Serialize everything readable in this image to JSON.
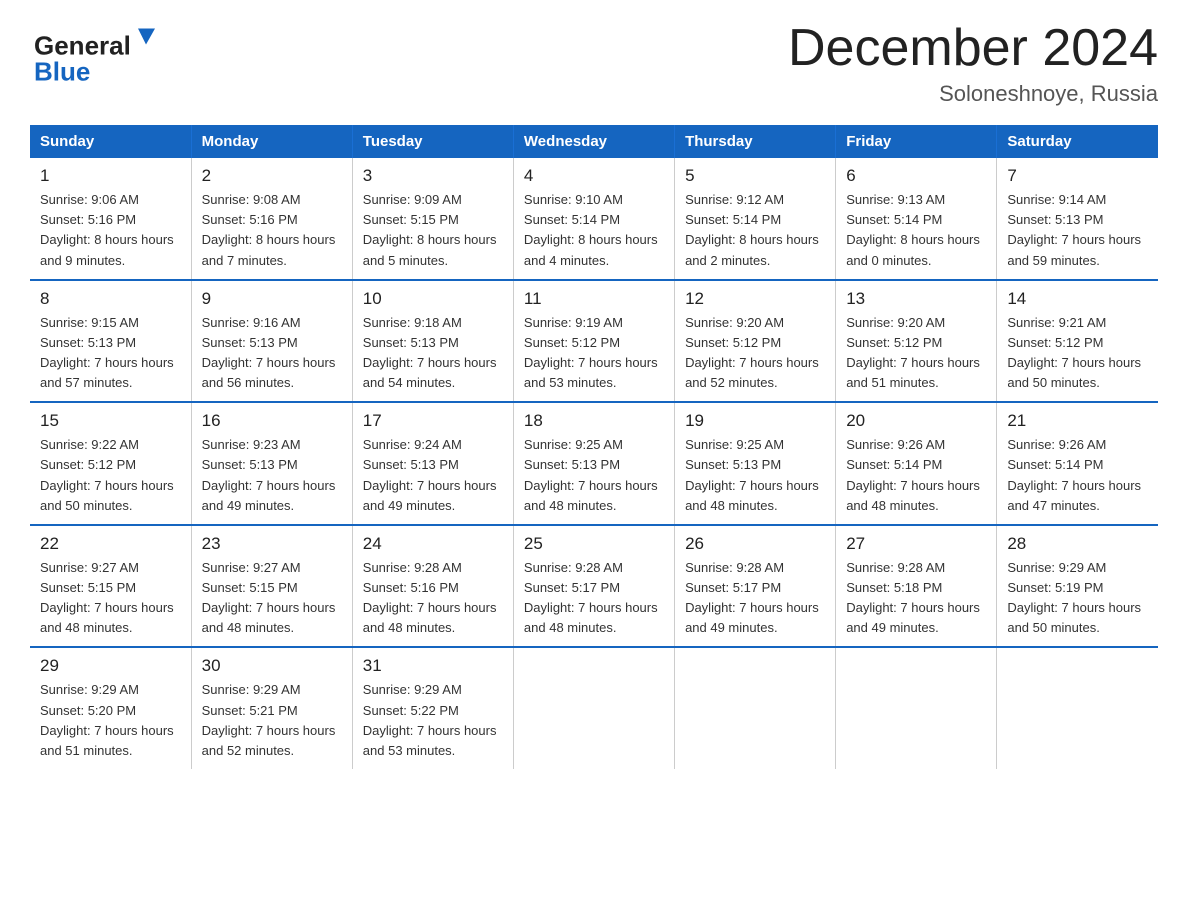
{
  "logo": {
    "line1": "General",
    "line2": "Blue",
    "triangle": "▶"
  },
  "title": "December 2024",
  "subtitle": "Soloneshnoye, Russia",
  "days_header": [
    "Sunday",
    "Monday",
    "Tuesday",
    "Wednesday",
    "Thursday",
    "Friday",
    "Saturday"
  ],
  "weeks": [
    [
      {
        "num": "1",
        "sunrise": "9:06 AM",
        "sunset": "5:16 PM",
        "daylight": "8 hours and 9 minutes."
      },
      {
        "num": "2",
        "sunrise": "9:08 AM",
        "sunset": "5:16 PM",
        "daylight": "8 hours and 7 minutes."
      },
      {
        "num": "3",
        "sunrise": "9:09 AM",
        "sunset": "5:15 PM",
        "daylight": "8 hours and 5 minutes."
      },
      {
        "num": "4",
        "sunrise": "9:10 AM",
        "sunset": "5:14 PM",
        "daylight": "8 hours and 4 minutes."
      },
      {
        "num": "5",
        "sunrise": "9:12 AM",
        "sunset": "5:14 PM",
        "daylight": "8 hours and 2 minutes."
      },
      {
        "num": "6",
        "sunrise": "9:13 AM",
        "sunset": "5:14 PM",
        "daylight": "8 hours and 0 minutes."
      },
      {
        "num": "7",
        "sunrise": "9:14 AM",
        "sunset": "5:13 PM",
        "daylight": "7 hours and 59 minutes."
      }
    ],
    [
      {
        "num": "8",
        "sunrise": "9:15 AM",
        "sunset": "5:13 PM",
        "daylight": "7 hours and 57 minutes."
      },
      {
        "num": "9",
        "sunrise": "9:16 AM",
        "sunset": "5:13 PM",
        "daylight": "7 hours and 56 minutes."
      },
      {
        "num": "10",
        "sunrise": "9:18 AM",
        "sunset": "5:13 PM",
        "daylight": "7 hours and 54 minutes."
      },
      {
        "num": "11",
        "sunrise": "9:19 AM",
        "sunset": "5:12 PM",
        "daylight": "7 hours and 53 minutes."
      },
      {
        "num": "12",
        "sunrise": "9:20 AM",
        "sunset": "5:12 PM",
        "daylight": "7 hours and 52 minutes."
      },
      {
        "num": "13",
        "sunrise": "9:20 AM",
        "sunset": "5:12 PM",
        "daylight": "7 hours and 51 minutes."
      },
      {
        "num": "14",
        "sunrise": "9:21 AM",
        "sunset": "5:12 PM",
        "daylight": "7 hours and 50 minutes."
      }
    ],
    [
      {
        "num": "15",
        "sunrise": "9:22 AM",
        "sunset": "5:12 PM",
        "daylight": "7 hours and 50 minutes."
      },
      {
        "num": "16",
        "sunrise": "9:23 AM",
        "sunset": "5:13 PM",
        "daylight": "7 hours and 49 minutes."
      },
      {
        "num": "17",
        "sunrise": "9:24 AM",
        "sunset": "5:13 PM",
        "daylight": "7 hours and 49 minutes."
      },
      {
        "num": "18",
        "sunrise": "9:25 AM",
        "sunset": "5:13 PM",
        "daylight": "7 hours and 48 minutes."
      },
      {
        "num": "19",
        "sunrise": "9:25 AM",
        "sunset": "5:13 PM",
        "daylight": "7 hours and 48 minutes."
      },
      {
        "num": "20",
        "sunrise": "9:26 AM",
        "sunset": "5:14 PM",
        "daylight": "7 hours and 48 minutes."
      },
      {
        "num": "21",
        "sunrise": "9:26 AM",
        "sunset": "5:14 PM",
        "daylight": "7 hours and 47 minutes."
      }
    ],
    [
      {
        "num": "22",
        "sunrise": "9:27 AM",
        "sunset": "5:15 PM",
        "daylight": "7 hours and 48 minutes."
      },
      {
        "num": "23",
        "sunrise": "9:27 AM",
        "sunset": "5:15 PM",
        "daylight": "7 hours and 48 minutes."
      },
      {
        "num": "24",
        "sunrise": "9:28 AM",
        "sunset": "5:16 PM",
        "daylight": "7 hours and 48 minutes."
      },
      {
        "num": "25",
        "sunrise": "9:28 AM",
        "sunset": "5:17 PM",
        "daylight": "7 hours and 48 minutes."
      },
      {
        "num": "26",
        "sunrise": "9:28 AM",
        "sunset": "5:17 PM",
        "daylight": "7 hours and 49 minutes."
      },
      {
        "num": "27",
        "sunrise": "9:28 AM",
        "sunset": "5:18 PM",
        "daylight": "7 hours and 49 minutes."
      },
      {
        "num": "28",
        "sunrise": "9:29 AM",
        "sunset": "5:19 PM",
        "daylight": "7 hours and 50 minutes."
      }
    ],
    [
      {
        "num": "29",
        "sunrise": "9:29 AM",
        "sunset": "5:20 PM",
        "daylight": "7 hours and 51 minutes."
      },
      {
        "num": "30",
        "sunrise": "9:29 AM",
        "sunset": "5:21 PM",
        "daylight": "7 hours and 52 minutes."
      },
      {
        "num": "31",
        "sunrise": "9:29 AM",
        "sunset": "5:22 PM",
        "daylight": "7 hours and 53 minutes."
      },
      null,
      null,
      null,
      null
    ]
  ],
  "labels": {
    "sunrise": "Sunrise:",
    "sunset": "Sunset:",
    "daylight": "Daylight:"
  }
}
